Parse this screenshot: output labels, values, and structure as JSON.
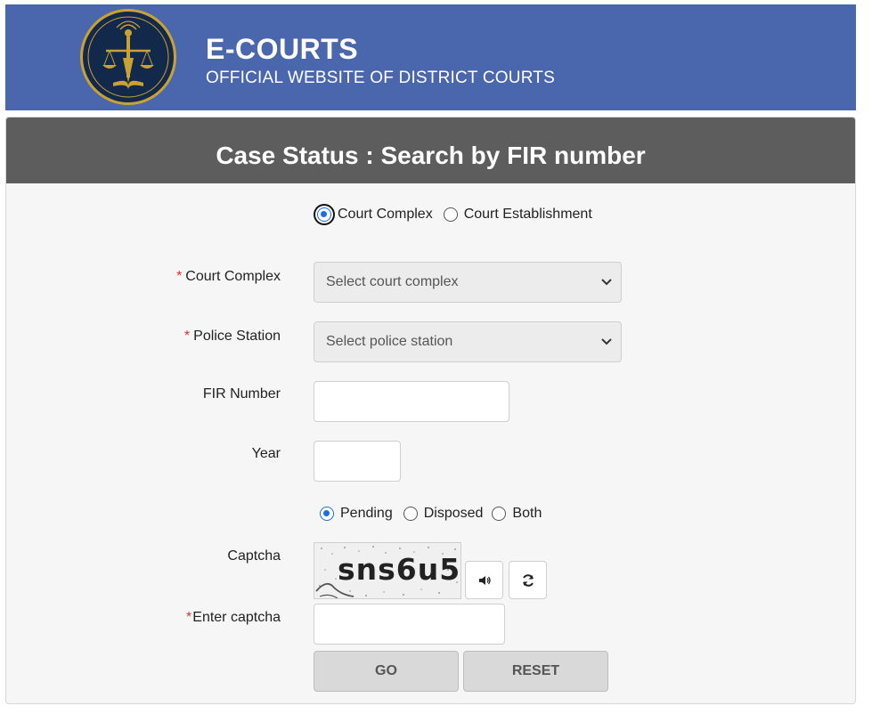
{
  "header": {
    "title": "E-COURTS",
    "subtitle": "OFFICIAL WEBSITE OF DISTRICT COURTS",
    "logo_icon": "ecourts-emblem-icon"
  },
  "panel": {
    "title": "Case Status : Search by FIR number"
  },
  "search_type": {
    "options": [
      {
        "label": "Court Complex",
        "selected": true
      },
      {
        "label": "Court Establishment",
        "selected": false
      }
    ]
  },
  "form": {
    "court_complex": {
      "label": "Court Complex",
      "required": "*",
      "selected_value": "Select court complex"
    },
    "police_station": {
      "label": "Police Station",
      "required": "*",
      "selected_value": "Select police station"
    },
    "fir_number": {
      "label": "FIR Number",
      "value": ""
    },
    "year": {
      "label": "Year",
      "value": ""
    },
    "case_status": {
      "options": [
        {
          "label": "Pending",
          "selected": true
        },
        {
          "label": "Disposed",
          "selected": false
        },
        {
          "label": "Both",
          "selected": false
        }
      ]
    },
    "captcha": {
      "label": "Captcha",
      "text": "sns6u5",
      "audio_icon": "speaker-icon",
      "refresh_icon": "refresh-icon"
    },
    "enter_captcha": {
      "label": "Enter captcha",
      "required": "*",
      "value": ""
    }
  },
  "buttons": {
    "go": "GO",
    "reset": "RESET"
  },
  "colors": {
    "header_bg": "#4a67ae",
    "panel_head_bg": "#5d5d5d",
    "required": "#d9342b",
    "radio_active": "#1a6ee8",
    "logo_bg": "#13294b",
    "logo_gold": "#c9a234"
  }
}
